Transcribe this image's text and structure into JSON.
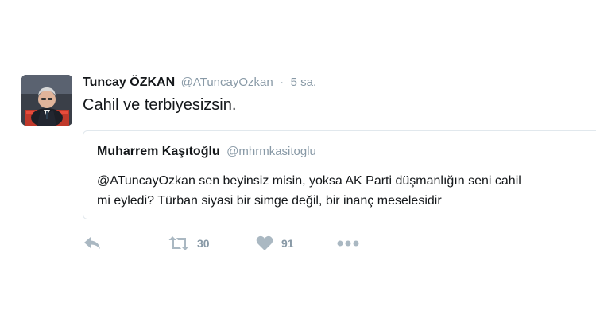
{
  "tweet": {
    "author_name": "Tuncay ÖZKAN",
    "author_handle": "@ATuncayOzkan",
    "separator": "·",
    "time": "5 sa.",
    "text": "Cahil ve terbiyesizsin."
  },
  "quoted_tweet": {
    "author_name": "Muharrem Kaşıtoğlu",
    "author_handle": "@mhrmkasitoglu",
    "text": "@ATuncayOzkan sen beyinsiz misin,  yoksa AK Parti düşmanlığın seni cahil\nmi eyledi? Türban siyasi bir simge değil, bir inanç meselesidir"
  },
  "actions": {
    "reply_icon": "reply-icon",
    "retweet_icon": "retweet-icon",
    "retweet_count": "30",
    "like_icon": "heart-icon",
    "like_count": "91",
    "more_icon": "more-icon"
  },
  "colors": {
    "text": "#14171a",
    "muted": "#8899a6",
    "border": "#e1e8ed",
    "icon": "#aab8c2"
  }
}
